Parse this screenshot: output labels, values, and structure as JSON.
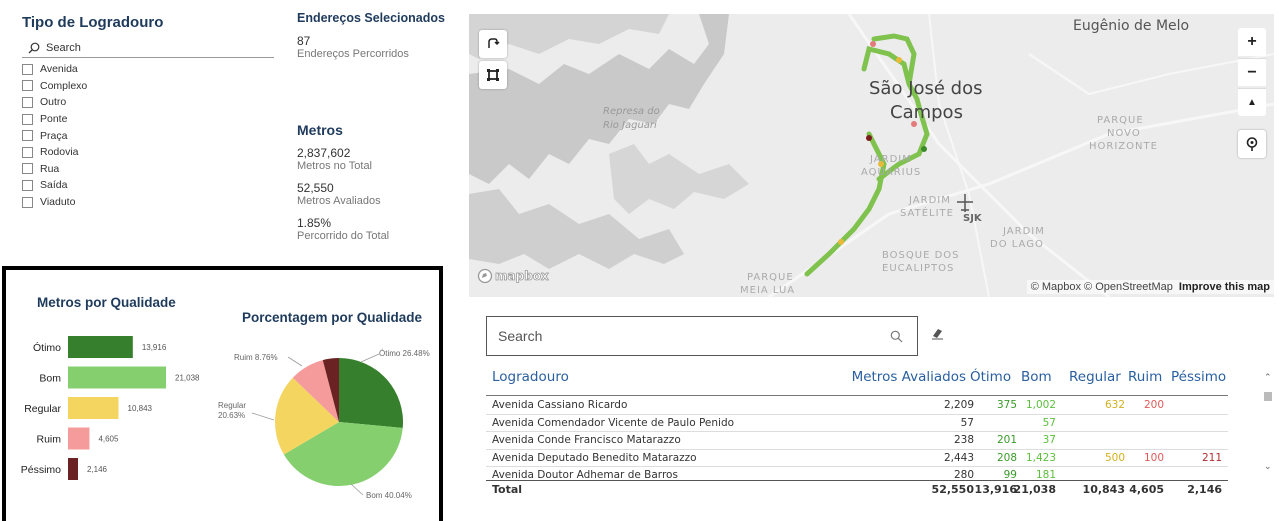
{
  "slicer": {
    "title": "Tipo de Logradouro",
    "search_placeholder": "Search",
    "items": [
      "Avenida",
      "Complexo",
      "Outro",
      "Ponte",
      "Praça",
      "Rodovia",
      "Rua",
      "Saída",
      "Viaduto"
    ]
  },
  "cards": {
    "enderecos": {
      "title": "Endereços Selecionados",
      "value": "87",
      "label": "Endereços Percorridos"
    },
    "metros": {
      "title": "Metros",
      "total_value": "2,837,602",
      "total_label": "Metros no Total",
      "avaliados_value": "52,550",
      "avaliados_label": "Metros Avaliados",
      "pct_value": "1.85%",
      "pct_label": "Percorrido do Total"
    }
  },
  "colors": {
    "otimo": "#36802d",
    "bom": "#86cf6f",
    "regular": "#f4d55f",
    "ruim": "#f59b9b",
    "pessimo": "#6b2222",
    "title_blue": "#1f3b5c",
    "link_blue": "#2a5fa0"
  },
  "chart_data": [
    {
      "type": "bar",
      "title": "Metros por Qualidade",
      "categories": [
        "Ótimo",
        "Bom",
        "Regular",
        "Ruim",
        "Péssimo"
      ],
      "values": [
        13916,
        21038,
        10843,
        4605,
        2146
      ],
      "value_labels": [
        "13,916",
        "21,038",
        "10,843",
        "4,605",
        "2,146"
      ],
      "orientation": "horizontal",
      "xlim": [
        0,
        21038
      ],
      "grid": false
    },
    {
      "type": "pie",
      "title": "Porcentagem por Qualidade",
      "categories": [
        "Ótimo",
        "Bom",
        "Regular",
        "Ruim",
        "Péssimo"
      ],
      "values": [
        26.48,
        40.04,
        20.63,
        8.76,
        4.08
      ],
      "labels": [
        "Ótimo 26.48%",
        "Bom 40.04%",
        "Regular 20.63%",
        "Ruim 8.76%",
        ""
      ]
    }
  ],
  "map": {
    "labels": {
      "city1": "São José dos",
      "city2": "Campos",
      "eugenio": "Eugênio de Melo",
      "parque_novo1": "PARQUE",
      "parque_novo2": "NOVO",
      "parque_novo3": "HORIZONTE",
      "represa1": "Represa do",
      "represa2": "Rio Jaguari",
      "jardim_aq1": "JARDIM",
      "jardim_aq2": "AQUARIUS",
      "jardim_sat1": "JARDIM",
      "jardim_sat2": "SATÉLITE",
      "sjk": "SJK",
      "jardim_lago1": "JARDIM",
      "jardim_lago2": "DO LAGO",
      "bosque1": "BOSQUE DOS",
      "bosque2": "EUCALIPTOS",
      "parque_meia1": "PARQUE",
      "parque_meia2": "MEIA LUA"
    },
    "logo": "mapbox",
    "attribution": "© Mapbox © OpenStreetMap",
    "improve": "Improve this map",
    "zoom_in": "+",
    "zoom_out": "−",
    "compass": "▲"
  },
  "table": {
    "search_placeholder": "Search",
    "headers": {
      "logradouro": "Logradouro",
      "metros": "Metros Avaliados",
      "otimo": "Ótimo",
      "bom": "Bom",
      "regular": "Regular",
      "ruim": "Ruim",
      "pessimo": "Péssimo"
    },
    "rows": [
      {
        "logradouro": "Avenida Cassiano Ricardo",
        "metros": "2,209",
        "otimo": "375",
        "bom": "1,002",
        "regular": "632",
        "ruim": "200",
        "pessimo": ""
      },
      {
        "logradouro": "Avenida Comendador Vicente de Paulo Penido",
        "metros": "57",
        "otimo": "",
        "bom": "57",
        "regular": "",
        "ruim": "",
        "pessimo": ""
      },
      {
        "logradouro": "Avenida Conde Francisco Matarazzo",
        "metros": "238",
        "otimo": "201",
        "bom": "37",
        "regular": "",
        "ruim": "",
        "pessimo": ""
      },
      {
        "logradouro": "Avenida Deputado Benedito Matarazzo",
        "metros": "2,443",
        "otimo": "208",
        "bom": "1,423",
        "regular": "500",
        "ruim": "100",
        "pessimo": "211"
      },
      {
        "logradouro": "Avenida Doutor Adhemar de Barros",
        "metros": "280",
        "otimo": "99",
        "bom": "181",
        "regular": "",
        "ruim": "",
        "pessimo": ""
      }
    ],
    "total": {
      "logradouro": "Total",
      "metros": "52,550",
      "otimo": "13,916",
      "bom": "21,038",
      "regular": "10,843",
      "ruim": "4,605",
      "pessimo": "2,146"
    }
  }
}
